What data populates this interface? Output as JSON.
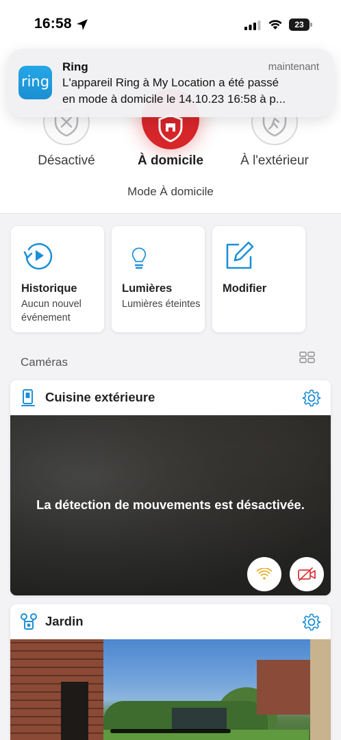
{
  "status_bar": {
    "time": "16:58",
    "battery": "23"
  },
  "notification": {
    "app_icon_text": "ring",
    "app": "Ring",
    "time": "maintenant",
    "line1": "L'appareil Ring à My Location a été passé",
    "line2": "en mode à domicile le 14.10.23 16:58 à p..."
  },
  "modes": {
    "items": [
      {
        "label": "Désactivé",
        "icon": "shield-off-icon"
      },
      {
        "label": "À domicile",
        "icon": "shield-home-icon",
        "active": true
      },
      {
        "label": "À l'extérieur",
        "icon": "shield-away-icon"
      }
    ],
    "caption": "Mode À domicile"
  },
  "actions": [
    {
      "title": "Historique",
      "subtitle": "Aucun nouvel événement",
      "icon": "history-icon"
    },
    {
      "title": "Lumières",
      "subtitle": "Lumières éteintes",
      "icon": "lightbulb-icon"
    },
    {
      "title": "Modifier",
      "subtitle": "",
      "icon": "edit-icon"
    }
  ],
  "cameras": {
    "section_label": "Caméras",
    "items": [
      {
        "name": "Cuisine extérieure",
        "message": "La détection de mouvements est désactivée."
      },
      {
        "name": "Jardin"
      }
    ]
  },
  "colors": {
    "accent": "#1c8fd6",
    "alarm_red": "#d6262a",
    "wifi_yellow": "#e5b12a",
    "disabled_red": "#d9363a"
  }
}
